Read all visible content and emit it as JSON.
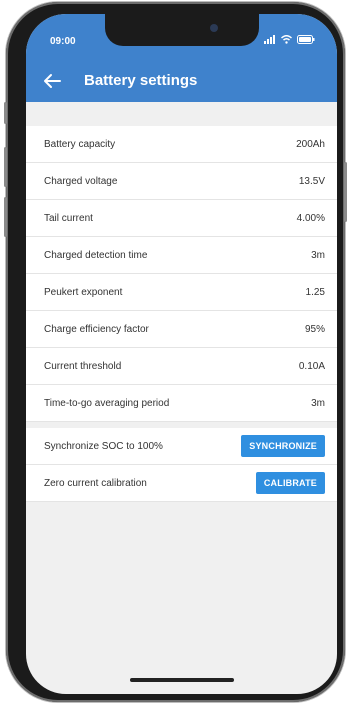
{
  "status_bar": {
    "time": "09:00"
  },
  "header": {
    "title": "Battery settings"
  },
  "settings": [
    {
      "label": "Battery capacity",
      "value": "200Ah"
    },
    {
      "label": "Charged voltage",
      "value": "13.5V"
    },
    {
      "label": "Tail current",
      "value": "4.00%"
    },
    {
      "label": "Charged detection time",
      "value": "3m"
    },
    {
      "label": "Peukert exponent",
      "value": "1.25"
    },
    {
      "label": "Charge efficiency factor",
      "value": "95%"
    },
    {
      "label": "Current threshold",
      "value": "0.10A"
    },
    {
      "label": "Time-to-go averaging period",
      "value": "3m"
    }
  ],
  "actions": [
    {
      "label": "Synchronize SOC to 100%",
      "button": "SYNCHRONIZE"
    },
    {
      "label": "Zero current calibration",
      "button": "CALIBRATE"
    }
  ],
  "colors": {
    "header": "#3f82cc",
    "button": "#2f8fe0",
    "background": "#f0f0f0"
  }
}
